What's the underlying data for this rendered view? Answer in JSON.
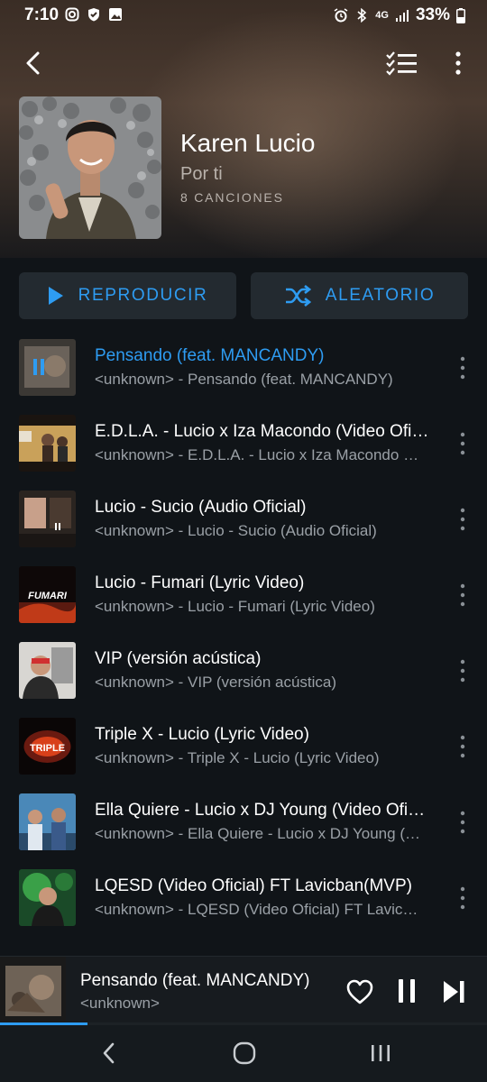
{
  "status_bar": {
    "time": "7:10",
    "network": "4G",
    "battery": "33%"
  },
  "header": {
    "artist": "Karen Lucio",
    "album": "Por ti",
    "song_count": "8 CANCIONES"
  },
  "actions": {
    "play_label": "REPRODUCIR",
    "shuffle_label": "ALEATORIO"
  },
  "tracks": [
    {
      "title": "Pensando (feat. MANCANDY)",
      "subtitle": "<unknown> - Pensando (feat. MANCANDY)",
      "playing": true
    },
    {
      "title": "E.D.L.A. - Lucio x Iza Macondo (Video Oficial)",
      "subtitle": "<unknown> - E.D.L.A. - Lucio x Iza Macondo (Video Oficial)"
    },
    {
      "title": "Lucio - Sucio (Audio Oficial)",
      "subtitle": "<unknown> - Lucio - Sucio (Audio Oficial)"
    },
    {
      "title": "Lucio - Fumari (Lyric Video)",
      "subtitle": "<unknown> - Lucio - Fumari (Lyric Video)",
      "thumb_text": "FUMARI"
    },
    {
      "title": "VIP (versión acústica)",
      "subtitle": "<unknown> - VIP (versión acústica)"
    },
    {
      "title": "Triple X - Lucio (Lyric Video)",
      "subtitle": "<unknown> - Triple X - Lucio (Lyric Video)",
      "thumb_text": "TRIPLE"
    },
    {
      "title": "Ella Quiere - Lucio x DJ Young (Video Oficial)",
      "subtitle": "<unknown> - Ella Quiere - Lucio x DJ Young (Video Oficial)"
    },
    {
      "title": "LQESD (Video Oficial) FT Lavicban(MVP)",
      "subtitle": "<unknown> - LQESD (Video Oficial) FT Lavicban(MVP)"
    }
  ],
  "mini_player": {
    "title": "Pensando (feat. MANCANDY)",
    "subtitle": "<unknown>",
    "progress_percent": 18
  },
  "colors": {
    "accent": "#2e9cf2",
    "background": "#101418"
  }
}
